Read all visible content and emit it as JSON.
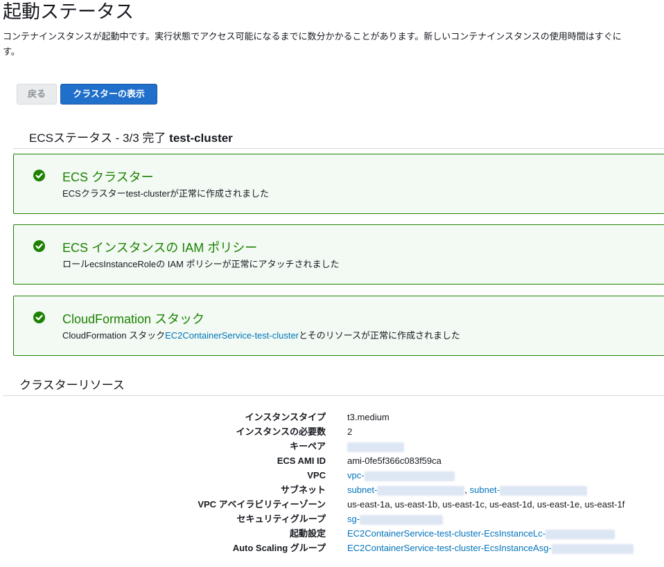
{
  "page": {
    "title": "起動ステータス",
    "intro_line1": "コンテナインスタンスが起動中です。実行状態でアクセス可能になるまでに数分かかることがあります。新しいコンテナインスタンスの使用時間はすぐに",
    "intro_line2": "す。"
  },
  "buttons": {
    "back": "戻る",
    "show_cluster": "クラスターの表示"
  },
  "status": {
    "prefix": "ECSステータス - 3/3 完了",
    "cluster_name": "test-cluster",
    "cards": [
      {
        "title": "ECS クラスター",
        "desc": "ECSクラスターtest-clusterが正常に作成されました"
      },
      {
        "title": "ECS インスタンスの IAM ポリシー",
        "desc": "ロールecsInstanceRoleの IAM ポリシーが正常にアタッチされました"
      },
      {
        "title": "CloudFormation スタック",
        "desc_before": "CloudFormation スタック",
        "desc_link": "EC2ContainerService-test-cluster",
        "desc_after": "とそのリソースが正常に作成されました"
      }
    ]
  },
  "resources": {
    "title": "クラスターリソース",
    "rows": [
      {
        "label": "インスタンスタイプ",
        "value": "t3.medium"
      },
      {
        "label": "インスタンスの必要数",
        "value": "2"
      },
      {
        "label": "キーペア",
        "value": ""
      },
      {
        "label": "ECS AMI ID",
        "value": "ami-0fe5f366c083f59ca"
      },
      {
        "label": "VPC",
        "value": "vpc-"
      },
      {
        "label": "サブネット",
        "value": "subnet-",
        "value2": "subnet-",
        "separator": ","
      },
      {
        "label": "VPC アベイラビリティーゾーン",
        "value": "us-east-1a, us-east-1b, us-east-1c, us-east-1d, us-east-1e, us-east-1f"
      },
      {
        "label": "セキュリティグループ",
        "value": "sg-"
      },
      {
        "label": "起動設定",
        "value": "EC2ContainerService-test-cluster-EcsInstanceLc-"
      },
      {
        "label": "Auto Scaling グループ",
        "value": "EC2ContainerService-test-cluster-EcsInstanceAsg-"
      }
    ]
  },
  "colors": {
    "success_green": "#1d8102",
    "card_bg": "#f2faf3",
    "primary_button": "#1f6fcb",
    "link": "#0073bb"
  },
  "icons": {
    "card_status": "check-circle-icon"
  }
}
